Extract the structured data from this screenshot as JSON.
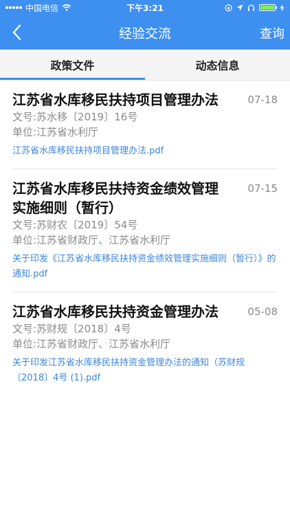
{
  "status_bar": {
    "carrier": "中国电信",
    "time": "下午3:21"
  },
  "nav": {
    "title": "经验交流",
    "query_label": "查询"
  },
  "tabs": [
    {
      "label": "政策文件",
      "active": true
    },
    {
      "label": "动态信息",
      "active": false
    }
  ],
  "items": [
    {
      "title": "江苏省水库移民扶持项目管理办法",
      "date": "07-18",
      "doc_no": "文号:苏水移〔2019〕16号",
      "unit": "单位:江苏省水利厅",
      "attachment": "江苏省水库移民扶持项目管理办法.pdf"
    },
    {
      "title": "江苏省水库移民扶持资金绩效管理实施细则（暂行）",
      "date": "07-15",
      "doc_no": "文号:苏财农〔2019〕54号",
      "unit": "单位:江苏省财政厅、江苏省水利厅",
      "attachment": "关于印发《江苏省水库移民扶持资金绩效管理实施细则（暂行）》的通知.pdf"
    },
    {
      "title": "江苏省水库移民扶持资金管理办法",
      "date": "05-08",
      "doc_no": "文号:苏财规〔2018〕4号",
      "unit": "单位:江苏省财政厅、江苏省水利厅",
      "attachment": "关于印发江苏省水库移民扶持资金管理办法的通知（苏财规〔2018〕4号 (1).pdf"
    }
  ]
}
